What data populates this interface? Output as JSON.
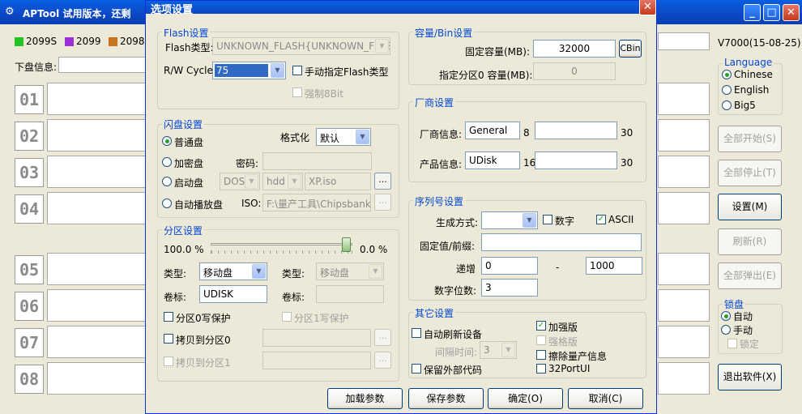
{
  "main": {
    "title": "APTool  试用版本，还剩",
    "version": "V7000(15-08-25)",
    "legend": [
      {
        "color": "#22c322",
        "label": "2099S"
      },
      {
        "color": "#9b30d9",
        "label": "2099"
      },
      {
        "color": "#c8741c",
        "label": "2098"
      }
    ],
    "disk_info_label": "下盘信息:",
    "slots": [
      "01",
      "02",
      "03",
      "04",
      "05",
      "06",
      "07",
      "08"
    ],
    "language": {
      "title": "Language",
      "options": [
        "Chinese",
        "English",
        "Big5"
      ],
      "selected": "Chinese"
    },
    "buttons": {
      "start_all": "全部开始(S)",
      "stop_all": "全部停止(T)",
      "settings": "设置(M)",
      "refresh": "刷新(R)",
      "eject_all": "全部弹出(E)",
      "exit": "退出软件(X)"
    },
    "lock": {
      "title": "锁盘",
      "auto": "自动",
      "manual": "手动",
      "lock": "锁定"
    }
  },
  "dialog": {
    "title": "选项设置",
    "flash": {
      "group": "Flash设置",
      "type_label": "Flash类型:",
      "type_value": "UNKNOWN_FLASH{UNKNOWN_FLASH",
      "rw_label": "R/W Cycle:",
      "rw_value": "75",
      "manual_type": "手动指定Flash类型",
      "force_8bit": "强制8Bit"
    },
    "udisk": {
      "group": "闪盘设置",
      "normal": "普通盘",
      "encrypted": "加密盘",
      "boot": "启动盘",
      "autoplay": "自动播放盘",
      "format_label": "格式化",
      "format_value": "默认",
      "password_label": "密码:",
      "dos_value": "DOS",
      "hdd_value": "hdd",
      "iso_file": "XP.iso",
      "iso_label": "ISO:",
      "iso_path": "F:\\量产工具\\Chipsbank\\C",
      "dots": "..."
    },
    "partition": {
      "group": "分区设置",
      "pct_left": "100.0 %",
      "pct_right": "0.0 %",
      "type_label": "类型:",
      "type_value": "移动盘",
      "type2_value": "移动盘",
      "vol_label": "卷标:",
      "vol_value": "UDISK",
      "protect0": "分区0写保护",
      "protect1": "分区1写保护",
      "copy0": "拷贝到分区0",
      "copy1": "拷贝到分区1",
      "slider_fraction": 1.0
    },
    "capacity": {
      "group": "容量/Bin设置",
      "fixed_label": "固定容量(MB):",
      "fixed_value": "32000",
      "cbin": "CBin",
      "part0_label": "指定分区0 容量(MB):",
      "part0_value": "0"
    },
    "vendor": {
      "group": "厂商设置",
      "vendor_label": "厂商信息:",
      "vendor_value": "General",
      "vendor_len": "8",
      "vendor_max": "30",
      "product_label": "产品信息:",
      "product_value": "UDisk",
      "product_len": "16",
      "product_max": "30"
    },
    "serial": {
      "group": "序列号设置",
      "gen_label": "生成方式:",
      "digit": "数字",
      "ascii": "ASCII",
      "prefix_label": "固定值/前缀:",
      "inc_label": "递增",
      "inc_from": "0",
      "dash": "-",
      "inc_to": "1000",
      "digits_label": "数字位数:",
      "digits_value": "3"
    },
    "other": {
      "group": "其它设置",
      "auto_refresh": "自动刷新设备",
      "interval_label": "间隔时间:",
      "interval_value": "3",
      "keep_code": "保留外部代码",
      "enhanced": "加强版",
      "strong": "强格版",
      "erase": "擦除量产信息",
      "port32": "32PortUI"
    },
    "buttons": {
      "load": "加载参数",
      "save": "保存参数",
      "ok": "确定(O)",
      "cancel": "取消(C)"
    }
  }
}
